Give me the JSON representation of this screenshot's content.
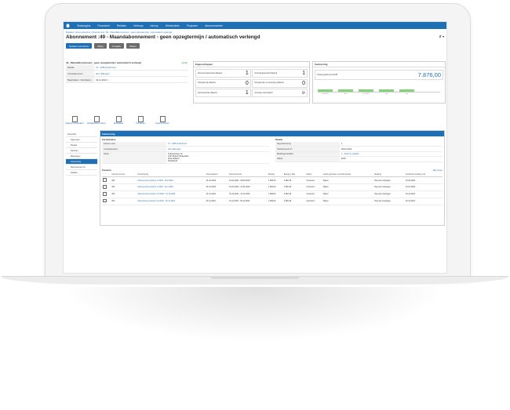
{
  "topnav": [
    "Startpagina",
    "Financieel",
    "Relaties",
    "Verkoop",
    "Inkoop",
    "Webwinkels",
    "Projecten",
    "Abonnementen"
  ],
  "breadcrumb": "Relaties / Abonnementen / Abonnement :49 - Maandabonnement - geen opzegtermijn / automatisch verlengd",
  "title": "Abonnement :49 - Maandabonnement - geen opzegtermijn / automatisch verlengd",
  "title_suffix": "⇵ ▾",
  "buttons": [
    "Opslaan met factuur",
    "Wijzig",
    "Verwijder",
    "Sluiten"
  ],
  "details": {
    "header": "49 - Maandabonnement - geen opzegtermijn / automatisch verlengd",
    "status": "Actief",
    "rows": [
      {
        "k": "Relatie",
        "v": "47 - A2B Onderhoud"
      },
      {
        "k": "Contactpersoon",
        "v": "den Uitbergen"
      },
      {
        "k": "Begindatum / Einddatum",
        "v": "01-11-2021 / -"
      }
    ]
  },
  "props": {
    "header": "Eigenschappen",
    "cells": [
      {
        "l": "Abonnementsperiode (Maand)",
        "n": "1"
      },
      {
        "l": "Verlengingsperiode (Maand)",
        "n": "1"
      },
      {
        "l": "Opzegtermijn (Maand)",
        "n": "0"
      },
      {
        "l": "Opzegtermijn na verlenging (Maand)",
        "n": "0"
      },
      {
        "l": "Factuurperiode (Maand)",
        "n": "1"
      },
      {
        "l": "Verlengen automatisch",
        "n": ""
      }
    ]
  },
  "invoicing": {
    "header": "Facturering",
    "total_label": "Totaal gefactureerd EUR",
    "total_value": "7.876,00",
    "bar_labels": [
      "nov 2021",
      "dec",
      "jan 2022",
      "feb",
      "mrt"
    ]
  },
  "icon_buttons": [
    "Volgende factuurdatum",
    "Eindafhandelen factuur",
    "Relatiekaart",
    "Transacties",
    "Email & Verkoop"
  ],
  "sidebar": [
    "Overzicht",
    "Algemeen",
    "Regels",
    "Rechten",
    "Boekingen",
    "Facturering",
    "Documenten (0)",
    "Notities"
  ],
  "main": {
    "header": "Facturering",
    "left_title": "Factuuradres",
    "left_rows": [
      {
        "k": "Factuur naar",
        "v": "47 - A2B Onderhoud",
        "link": true
      },
      {
        "k": "Contactpersoon",
        "v": "den Uitbergen",
        "link": true
      },
      {
        "k": "Adres",
        "v": "Industrieweg 12\n2147 Buiten Rotterdam\nZuid Holland\nNederland",
        "link": false
      }
    ],
    "right_title": "Details",
    "right_rows": [
      {
        "k": "Dag facturering",
        "v": "1",
        "link": false
      },
      {
        "k": "Gefactureerd t/m",
        "v": "28-02-2022",
        "link": false
      },
      {
        "k": "Betalingscondities",
        "v": "1 - direct te voldoen",
        "link": true
      },
      {
        "k": "Valuta",
        "v": "EUR",
        "link": false
      }
    ],
    "invoices_title": "Facturen",
    "add_label": "Alle tonen",
    "columns": [
      "",
      "Factuurnummer",
      "Omschrijving",
      "Factuurdatum",
      "Factuurperiode",
      "Bedrag",
      "Bedrag + Btw",
      "Status",
      "Laatst gebruikte verzendmethode",
      "Betaling",
      "Verwachte betaling voor"
    ],
    "rows": [
      [
        "",
        "264",
        "Abonnement periode 1-2-2022 - 28-2-2022",
        "01-02-2022",
        "01-02-2022 - 28-02-2022",
        "1.969,00",
        "2.382,49",
        "Verstuurd",
        "Papier",
        "Nog niet ontvangen",
        "16-02-2022"
      ],
      [
        "",
        "262",
        "Abonnement periode 1-1-2022 - 31-1-2022",
        "01-01-2022",
        "01-01-2022 - 31-01-2022",
        "1.969,00",
        "2.382,49",
        "Verstuurd",
        "Papier",
        "Nog niet ontvangen",
        "16-01-2022"
      ],
      [
        "",
        "260",
        "Abonnement periode 1-12-2021 - 31-12-2021",
        "01-12-2021",
        "01-12-2021 - 31-12-2021",
        "1.969,00",
        "2.382,49",
        "Verstuurd",
        "Papier",
        "Nog niet ontvangen",
        "16-12-2021"
      ],
      [
        "",
        "251",
        "Abonnement periode 1-11-2021 - 30-11-2021",
        "01-11-2021",
        "01-11-2021 - 30-11-2021",
        "1.969,00",
        "2.382,49",
        "Verstuurd",
        "Papier",
        "Nog niet ontvangen",
        "16-11-2021"
      ]
    ]
  }
}
